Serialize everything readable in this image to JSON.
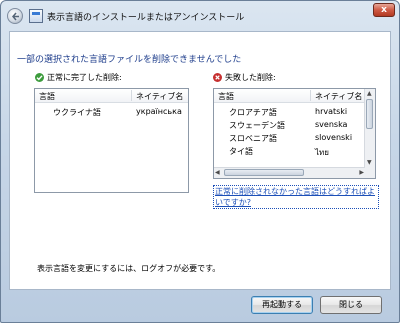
{
  "window": {
    "title": "表示言語のインストールまたはアンインストール",
    "close_glyph": "x"
  },
  "heading": "一部の選択された言語ファイルを削除できませんでした",
  "success": {
    "label": "正常に完了した削除:",
    "icon": "check-icon",
    "columns": [
      "言語",
      "ネイティブ名"
    ],
    "rows": [
      {
        "lang": "ウクライナ語",
        "native": "українська"
      }
    ]
  },
  "failed": {
    "label": "失敗した削除:",
    "icon": "error-x-icon",
    "columns": [
      "言語",
      "ネイティブ名"
    ],
    "rows": [
      {
        "lang": "クロアチア語",
        "native": "hrvatski"
      },
      {
        "lang": "スウェーデン語",
        "native": "svenska"
      },
      {
        "lang": "スロベニア語",
        "native": "slovenski"
      },
      {
        "lang": "タイ語",
        "native": "ไทย"
      }
    ]
  },
  "help_link": "正常に削除されなかった言語はどうすればよいですか?",
  "logoff_note": "表示言語を変更にするには、ログオフが必要です。",
  "buttons": {
    "restart": "再起動する",
    "close": "閉じる"
  }
}
